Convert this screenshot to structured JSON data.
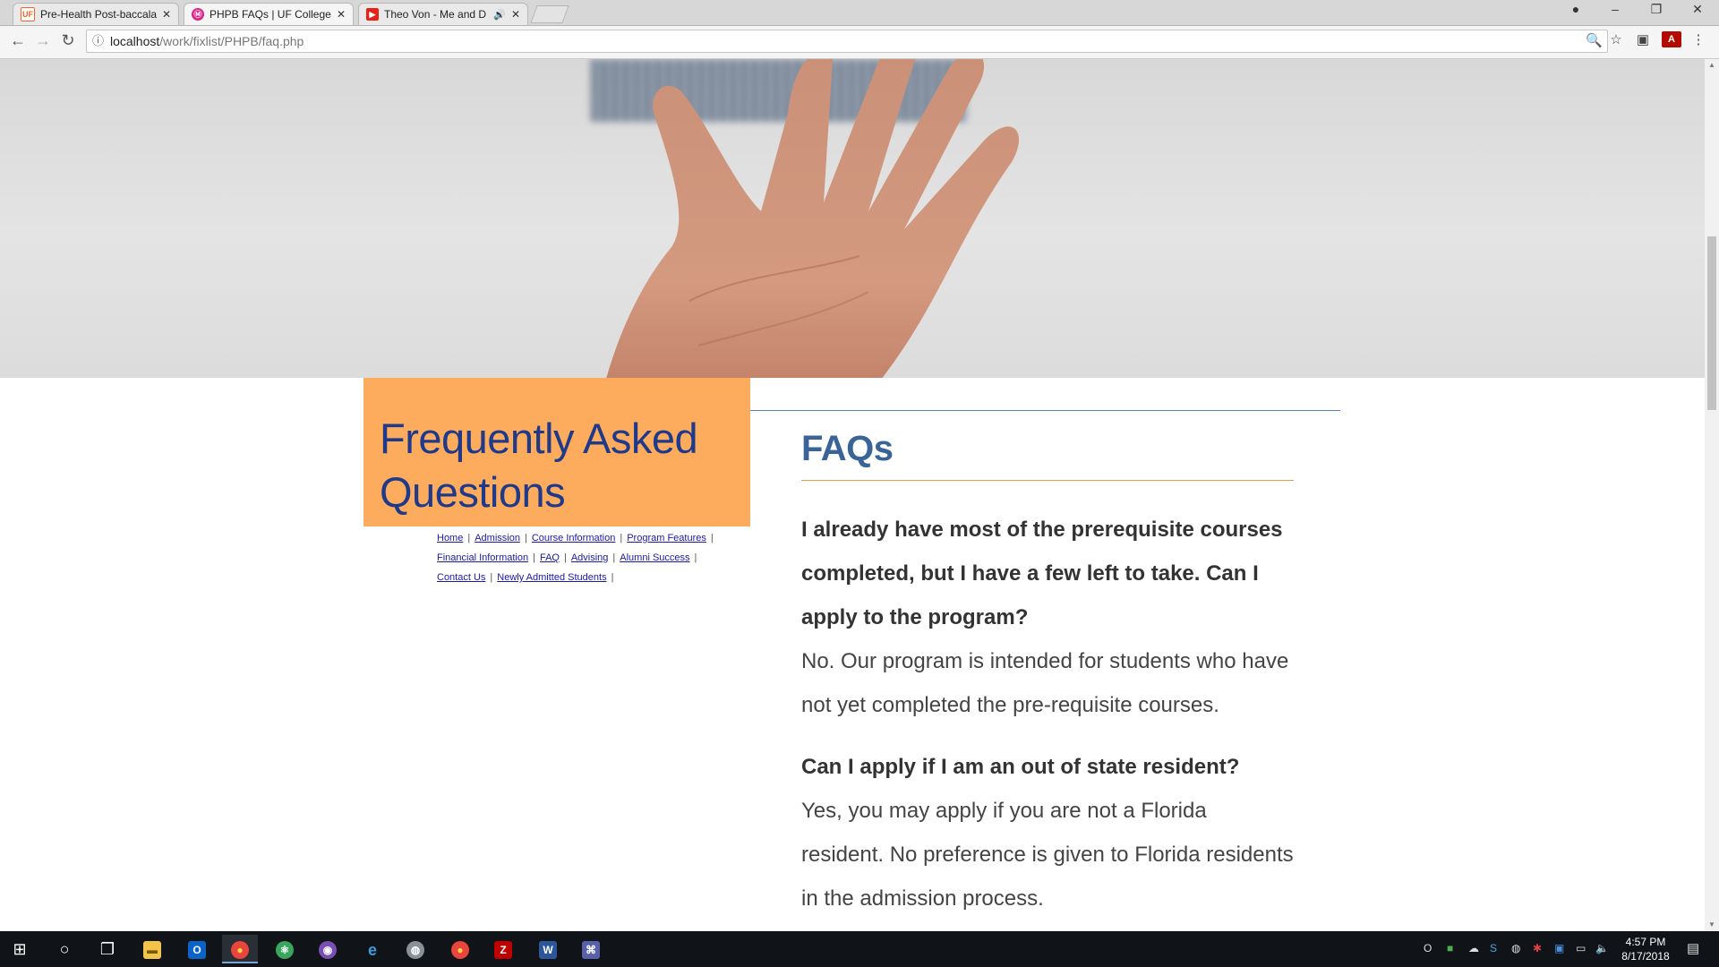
{
  "tabs": [
    {
      "title": "Pre-Health Post-baccalau",
      "favicon": "UF"
    },
    {
      "title": "PHPB FAQs | UF College o",
      "favicon": "Ⓜ"
    },
    {
      "title": "Theo Von - Me and D",
      "favicon": "▶"
    }
  ],
  "address_bar": {
    "host": "localhost",
    "path": "/work/fixlist/PHPB/faq.php"
  },
  "sidebar": {
    "heading": "Frequently Asked Questions",
    "nav": [
      "Home",
      "Admission",
      "Course Information",
      "Program Features",
      "Financial Information",
      "FAQ",
      "Advising",
      "Alumni Success",
      "Contact Us",
      "Newly Admitted Students"
    ]
  },
  "main": {
    "title": "FAQs",
    "faqs": [
      {
        "question": "I already have most of the prerequisite courses completed, but I have a few left to take. Can I apply to the program?",
        "answer": "No. Our program is intended for students who have not yet completed the pre-requisite courses."
      },
      {
        "question": "Can I apply if I am an out of state resident?",
        "answer": "Yes, you may apply if you are not a Florida resident. No preference is given to Florida residents in the admission process."
      }
    ]
  },
  "taskbar": {
    "time": "4:57 PM",
    "date": "8/17/2018"
  },
  "colors": {
    "sidebar_box": "#fdab5c",
    "heading_blue": "#1f3a8a",
    "faq_title": "#3a6497",
    "rule_orange": "#e0a040"
  }
}
